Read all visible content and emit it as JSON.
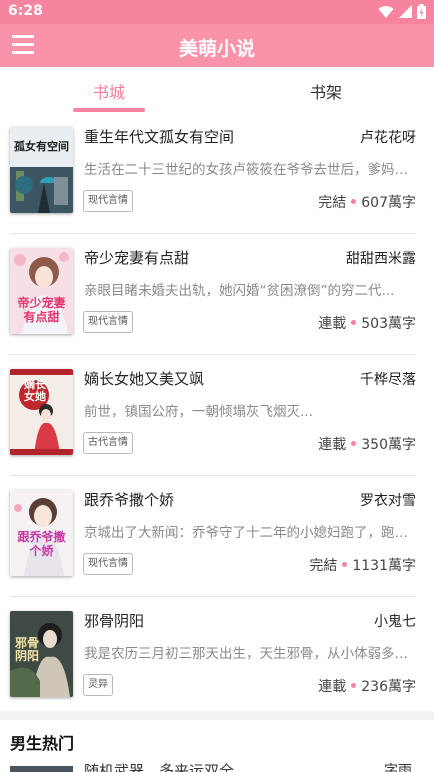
{
  "status": {
    "time": "6:28"
  },
  "appbar": {
    "title": "美萌小说"
  },
  "tabs": [
    {
      "label": "书城",
      "active": true
    },
    {
      "label": "书架",
      "active": false
    }
  ],
  "accent_color": "#f7849f",
  "books": [
    {
      "title": "重生年代文孤女有空间",
      "author": "卢花花呀",
      "desc": "生活在二十三世纪的女孩卢筱筱在爷爷去世后，爹妈不...",
      "tag": "现代言情",
      "status": "完結",
      "words": "607萬字",
      "cover_text": "孤女有空间"
    },
    {
      "title": "帝少宠妻有点甜",
      "author": "甜甜西米露",
      "desc": "亲眼目睹未婚夫出轨，她闪婚“贫困潦倒”的穷二代...",
      "tag": "现代言情",
      "status": "連載",
      "words": "503萬字",
      "cover_text": "帝少宠妻有点甜"
    },
    {
      "title": "嫡长女她又美又飒",
      "author": "千桦尽落",
      "desc": "前世，镇国公府，一朝倾塌灰飞烟灭...",
      "tag": "古代言情",
      "status": "連載",
      "words": "350萬字",
      "cover_text": "嫡长女她"
    },
    {
      "title": "跟乔爷撒个娇",
      "author": "罗衣对雪",
      "desc": "京城出了大新闻：乔爷守了十二年的小媳妇跑了，跑了...",
      "tag": "现代言情",
      "status": "完結",
      "words": "1131萬字",
      "cover_text": "跟乔爷撒个娇"
    },
    {
      "title": "邪骨阴阳",
      "author": "小鬼七",
      "desc": "我是农历三月初三那天出生，天生邪骨，从小体弱多病...",
      "tag": "灵异",
      "status": "連載",
      "words": "236萬字",
      "cover_text": "邪骨阴阳"
    }
  ],
  "section": {
    "title": "男生热门"
  },
  "peek": {
    "title": "随机武器，多来运双全",
    "author": "字雨"
  }
}
